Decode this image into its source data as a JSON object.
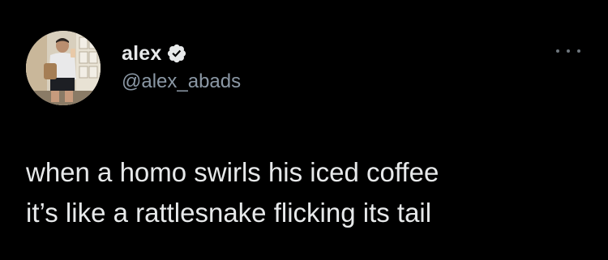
{
  "author": {
    "display_name": "alex",
    "handle": "@alex_abads",
    "verified": true,
    "verified_icon": "verified-badge-icon"
  },
  "menu": {
    "icon": "more-options-icon"
  },
  "tweet": {
    "line1": "when a homo swirls his iced coffee",
    "line2": "it’s like a rattlesnake flicking its tail"
  },
  "colors": {
    "background": "#000000",
    "text_primary": "#e7e9ea",
    "text_secondary": "#8b98a5"
  }
}
